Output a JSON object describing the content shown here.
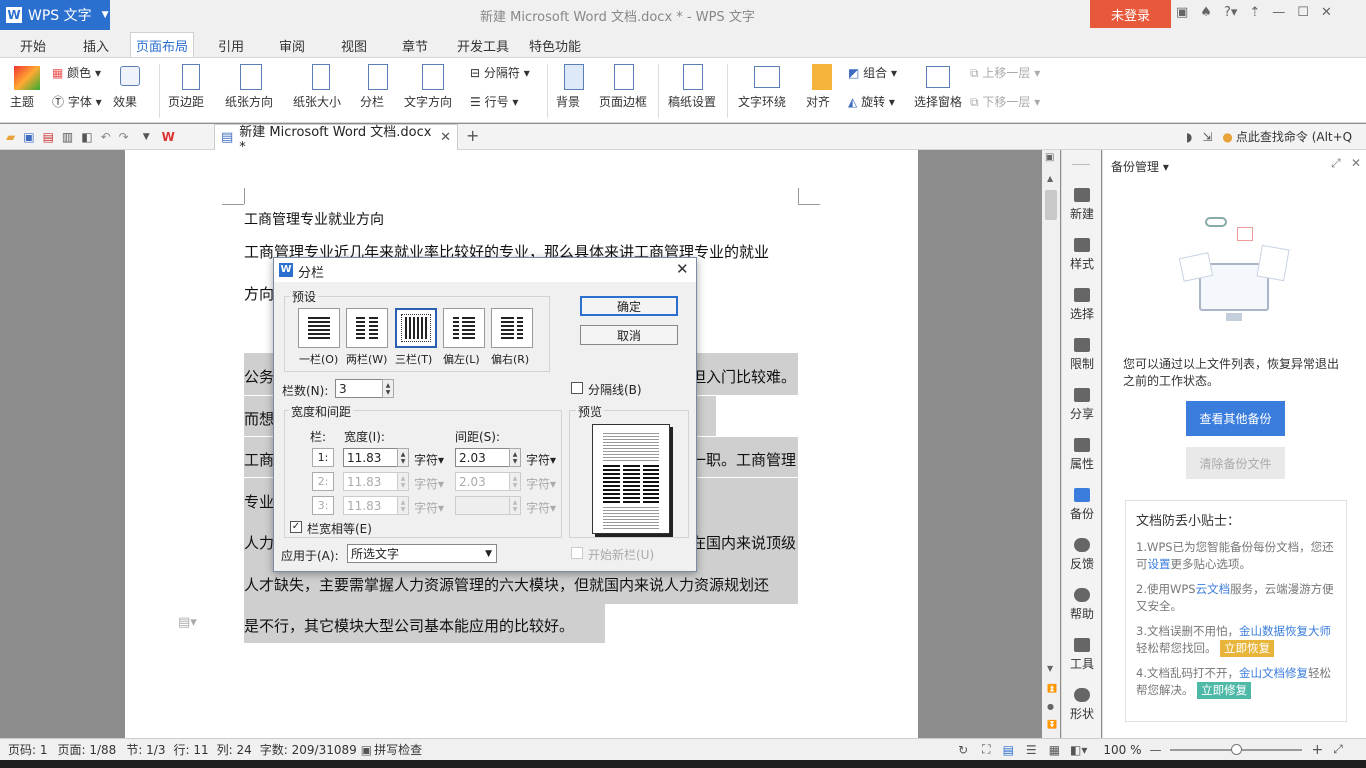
{
  "titlebar": {
    "app_name": "WPS 文字",
    "doc_title": "新建 Microsoft Word 文档.docx * - WPS 文字",
    "login": "未登录"
  },
  "tabs": [
    "开始",
    "插入",
    "页面布局",
    "引用",
    "审阅",
    "视图",
    "章节",
    "开发工具",
    "特色功能"
  ],
  "active_tab": "页面布局",
  "ribbon": {
    "theme": "主题",
    "colors": "颜色",
    "fonts": "字体",
    "effects": "效果",
    "margins": "页边距",
    "orientation": "纸张方向",
    "size": "纸张大小",
    "columns": "分栏",
    "text_direction": "文字方向",
    "breaks": "分隔符",
    "line_numbers": "行号",
    "background": "背景",
    "page_border": "页面边框",
    "grid_paper": "稿纸设置",
    "wrap_text": "文字环绕",
    "align": "对齐",
    "group": "组合",
    "rotate": "旋转",
    "selection_pane": "选择窗格",
    "bring_forward": "上移一层",
    "send_backward": "下移一层"
  },
  "doc_tab": {
    "name": "新建 Microsoft Word 文档.docx *"
  },
  "search_hint": "点此查找命令 (Alt+Q",
  "document": {
    "lines": [
      "工商管理专业就业方向",
      "工商管理专业近几年来就业率比较好的专业，那么具体来讲工商管理专业的就业",
      "方向",
      "公务",
      "但入门比较难。",
      "而想",
      "工商",
      "一职。工商管理",
      "专业",
      "人力",
      "在国内来说顶级",
      "人才缺失，主要需掌握人力资源管理的六大模块，但就国内来说人力资源规划还",
      "是不行，其它模块大型公司基本能应用的比较好。"
    ]
  },
  "sidebar": [
    "新建",
    "样式",
    "选择",
    "限制",
    "分享",
    "属性",
    "备份",
    "反馈",
    "帮助",
    "工具",
    "形状"
  ],
  "backup_panel": {
    "title": "备份管理",
    "desc": "您可以通过以上文件列表，恢复异常退出之前的工作状态。",
    "view_btn": "查看其他备份",
    "clear_btn": "清除备份文件",
    "tips_title": "文档防丢小贴士：",
    "tip1": {
      "a": "1.WPS已为您智能备份每份文档，您还可",
      "link": "设置",
      "b": "更多贴心选项。"
    },
    "tip2": {
      "a": "2.使用WPS",
      "link": "云文档",
      "b": "服务，云端漫游方便又安全。"
    },
    "tip3": {
      "a": "3.文档误删不用怕，",
      "link": "金山数据恢复大师",
      "b": "轻松帮您找回。",
      "tag": "立即恢复"
    },
    "tip4": {
      "a": "4.文档乱码打不开，",
      "link": "金山文档修复",
      "b": "轻松帮您解决。",
      "tag": "立即修复"
    }
  },
  "dialog": {
    "title": "分栏",
    "preset_label": "预设",
    "presets": [
      "一栏(O)",
      "两栏(W)",
      "三栏(T)",
      "偏左(L)",
      "偏右(R)"
    ],
    "selected_preset": "三栏(T)",
    "ok": "确定",
    "cancel": "取消",
    "num_label": "栏数(N):",
    "num_value": "3",
    "separator_label": "分隔线(B)",
    "width_spacing_label": "宽度和间距",
    "col_label": "栏:",
    "width_label": "宽度(I):",
    "spacing_label": "间距(S):",
    "unit": "字符",
    "rows": [
      {
        "idx": "1:",
        "width": "11.83",
        "spacing": "2.03"
      },
      {
        "idx": "2:",
        "width": "11.83",
        "spacing": "2.03"
      },
      {
        "idx": "3:",
        "width": "11.83",
        "spacing": ""
      }
    ],
    "equal_width_label": "栏宽相等(E)",
    "preview_label": "预览",
    "apply_label": "应用于(A):",
    "apply_value": "所选文字",
    "new_col_label": "开始新栏(U)"
  },
  "status": {
    "page": "页码: 1",
    "pages": "页面: 1/88",
    "section": "节: 1/3",
    "row": "行: 11",
    "col": "列: 24",
    "words": "字数: 209/31089",
    "spell": "拼写检查",
    "zoom": "100 %"
  },
  "colors": {
    "accent": "#2b6fcf",
    "login": "#e8593b",
    "primary_btn": "#3b7ddd"
  }
}
